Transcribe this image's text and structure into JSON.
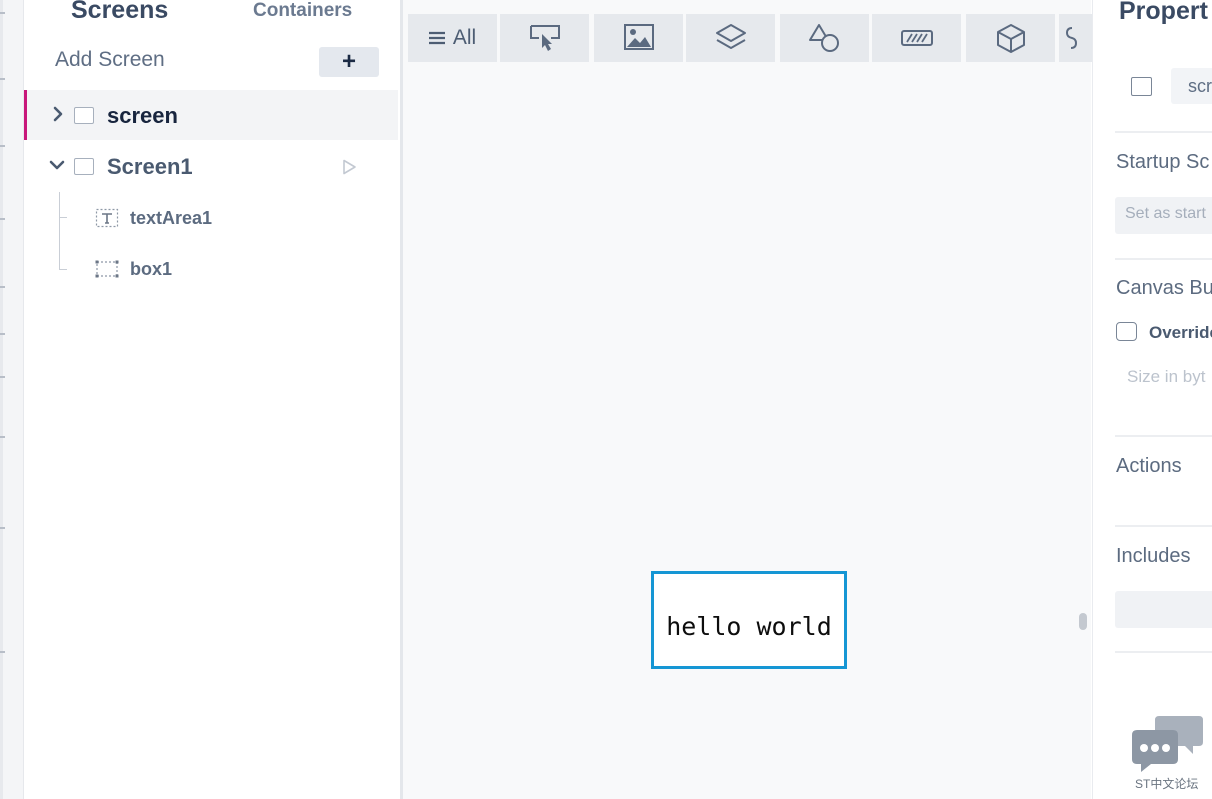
{
  "screens_panel": {
    "tab_screens": "Screens",
    "tab_containers": "Containers",
    "add_screen_label": "Add Screen",
    "add_button": "+",
    "tree": [
      {
        "label": "screen",
        "expanded": false,
        "selected": true
      },
      {
        "label": "Screen1",
        "expanded": true,
        "selected": false,
        "children": [
          {
            "label": "textArea1",
            "icon": "text-area-icon"
          },
          {
            "label": "box1",
            "icon": "box-icon"
          }
        ]
      }
    ]
  },
  "toolbar": {
    "all_label": "All",
    "buttons": [
      "all",
      "button-icon",
      "image-icon",
      "layers-icon",
      "shapes-icon",
      "progress-icon",
      "3d-cube-icon",
      "more-icon"
    ]
  },
  "canvas": {
    "text": "hello world",
    "border_color": "#1596d4"
  },
  "properties": {
    "title": "Propert",
    "name_value": "scr",
    "startup_title": "Startup Sc",
    "startup_button": "Set as start",
    "canvas_buffer_title": "Canvas Bu",
    "override_label": "Override",
    "size_label": "Size in byt",
    "actions_title": "Actions",
    "includes_title": "Includes"
  },
  "watermark": {
    "text": "ST中文论坛"
  },
  "colors": {
    "accent": "#c8177a",
    "selection_border": "#1596d4",
    "title_text": "#3a4a63"
  }
}
